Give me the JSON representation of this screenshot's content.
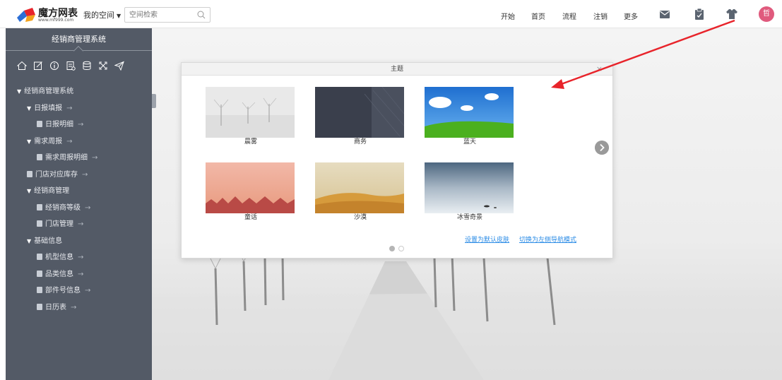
{
  "brand": {
    "name": "魔方网表",
    "url": "www.mf999.com"
  },
  "topbar": {
    "space_label": "我的空间",
    "search_placeholder": "空间检索",
    "nav": [
      "开始",
      "首页",
      "流程",
      "注销",
      "更多"
    ],
    "avatar_text": "哲"
  },
  "sidebar": {
    "title": "经销商管理系统",
    "tools": [
      "home-icon",
      "edit-icon",
      "info-icon",
      "report-icon",
      "database-icon",
      "expand-icon",
      "send-icon"
    ],
    "tree": [
      {
        "label": "经销商管理系统",
        "level": 0,
        "type": "folder",
        "arrow": ""
      },
      {
        "label": "日报填报",
        "level": 1,
        "type": "folder",
        "arrow": "→"
      },
      {
        "label": "日报明细",
        "level": 2,
        "type": "doc",
        "arrow": "→"
      },
      {
        "label": "需求周报",
        "level": 1,
        "type": "folder",
        "arrow": "→"
      },
      {
        "label": "需求周报明细",
        "level": 2,
        "type": "doc",
        "arrow": "→"
      },
      {
        "label": "门店对应库存",
        "level": 1,
        "type": "doc",
        "arrow": "→"
      },
      {
        "label": "经销商管理",
        "level": 1,
        "type": "folder",
        "arrow": ""
      },
      {
        "label": "经销商等级",
        "level": 2,
        "type": "doc",
        "arrow": "→"
      },
      {
        "label": "门店管理",
        "level": 2,
        "type": "doc",
        "arrow": "→"
      },
      {
        "label": "基础信息",
        "level": 1,
        "type": "folder",
        "arrow": ""
      },
      {
        "label": "机型信息",
        "level": 2,
        "type": "doc",
        "arrow": "→"
      },
      {
        "label": "品类信息",
        "level": 2,
        "type": "doc",
        "arrow": "→"
      },
      {
        "label": "部件号信息",
        "level": 2,
        "type": "doc",
        "arrow": "→"
      },
      {
        "label": "日历表",
        "level": 2,
        "type": "doc",
        "arrow": "→"
      }
    ]
  },
  "modal": {
    "title": "主题",
    "close": "×",
    "themes": [
      {
        "label": "晨雾"
      },
      {
        "label": "商务"
      },
      {
        "label": "蓝天"
      },
      {
        "label": "童话"
      },
      {
        "label": "沙漠"
      },
      {
        "label": "冰雪奇景"
      }
    ],
    "link_default": "设置为默认皮肤",
    "link_mode": "切换为左侧导航模式",
    "page_count": 2,
    "current_page": 1
  },
  "colors": {
    "sidebar_bg": "#535a66",
    "accent_link": "#2a8be6",
    "annotation_arrow": "#e8242b",
    "avatar_bg": "#e05a7d"
  }
}
